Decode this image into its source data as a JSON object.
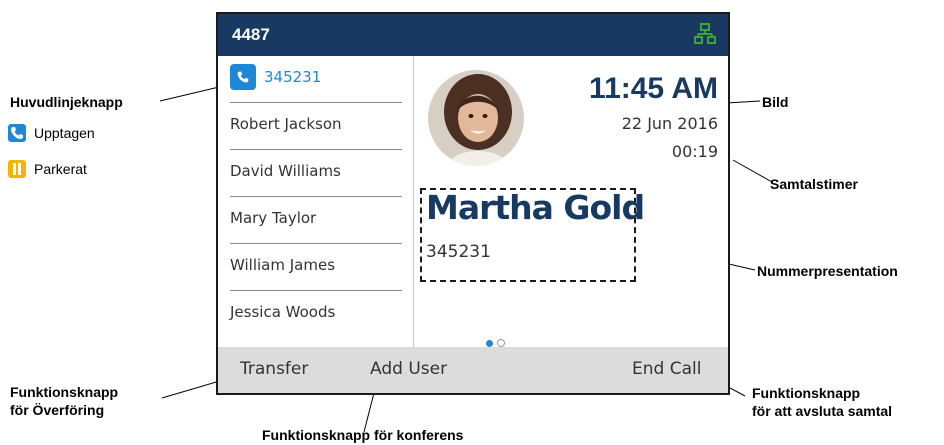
{
  "phone": {
    "line_number": "4487",
    "lines": [
      {
        "label": "345231",
        "active": true
      },
      {
        "label": "Robert Jackson"
      },
      {
        "label": "David Williams"
      },
      {
        "label": "Mary Taylor"
      },
      {
        "label": "William James"
      },
      {
        "label": "Jessica Woods"
      }
    ],
    "time": "11:45 AM",
    "date": "22 Jun 2016",
    "call_timer": "00:19",
    "caller_name": "Martha Gold",
    "caller_number": "345231",
    "softkeys": {
      "transfer": "Transfer",
      "add_user": "Add User",
      "end_call": "End Call"
    },
    "page_indicator": {
      "current": 1,
      "total": 2
    }
  },
  "callouts": {
    "main_line_key": "Huvudlinjeknapp",
    "busy": "Upptagen",
    "parked": "Parkerat",
    "picture": "Bild",
    "call_timer": "Samtalstimer",
    "caller_id": "Nummerpresentation",
    "transfer_line1": "Funktionsknapp",
    "transfer_line2": "för Överföring",
    "conference": "Funktionsknapp för konferens",
    "end_call_line1": "Funktionsknapp",
    "end_call_line2": "för att avsluta samtal"
  },
  "colors": {
    "title_bar": "#173962",
    "accent_blue": "#1e88d6",
    "parked_yellow": "#f4b400",
    "network_green": "#3aa53a"
  },
  "icons": [
    "phone-icon",
    "pause-icon",
    "network-icon"
  ]
}
